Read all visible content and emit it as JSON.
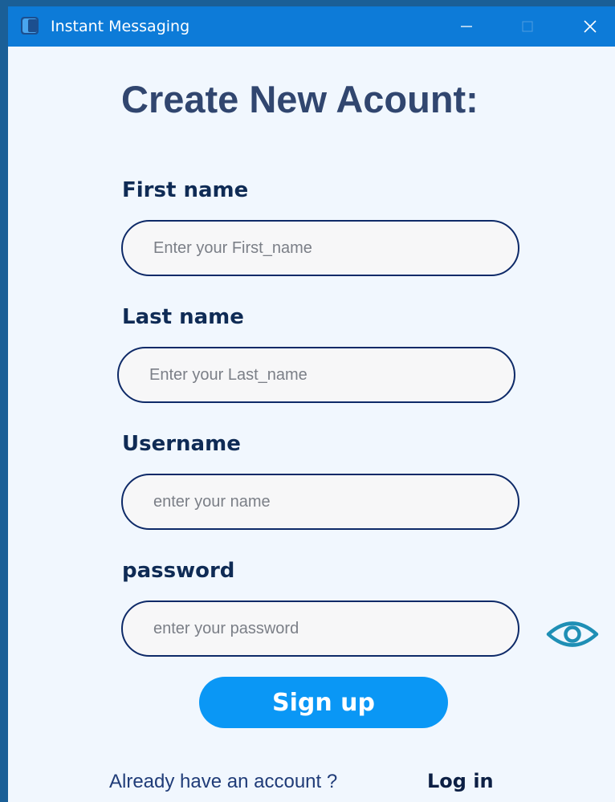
{
  "window": {
    "title": "Instant Messaging",
    "icons": {
      "app": "app-logo-icon",
      "minimize": "minimize-icon",
      "maximize": "maximize-icon",
      "close": "close-icon"
    }
  },
  "form": {
    "title": "Create New Acount:",
    "fields": [
      {
        "label": "First name",
        "placeholder": "Enter your First_name",
        "value": ""
      },
      {
        "label": "Last name",
        "placeholder": "Enter your Last_name",
        "value": ""
      },
      {
        "label": "Username",
        "placeholder": "enter your name",
        "value": ""
      },
      {
        "label": "password",
        "placeholder": "enter your password",
        "value": ""
      }
    ],
    "password_toggle_icon": "eye-icon",
    "submit_label": "Sign up",
    "footer_text": "Already have an account ?",
    "login_label": "Log in"
  },
  "colors": {
    "titlebar": "#0d7bd8",
    "background": "#f1f7fe",
    "heading": "#31466f",
    "field_border": "#0e2a68",
    "button": "#0a97f5",
    "eye_icon": "#1f8fb5"
  }
}
